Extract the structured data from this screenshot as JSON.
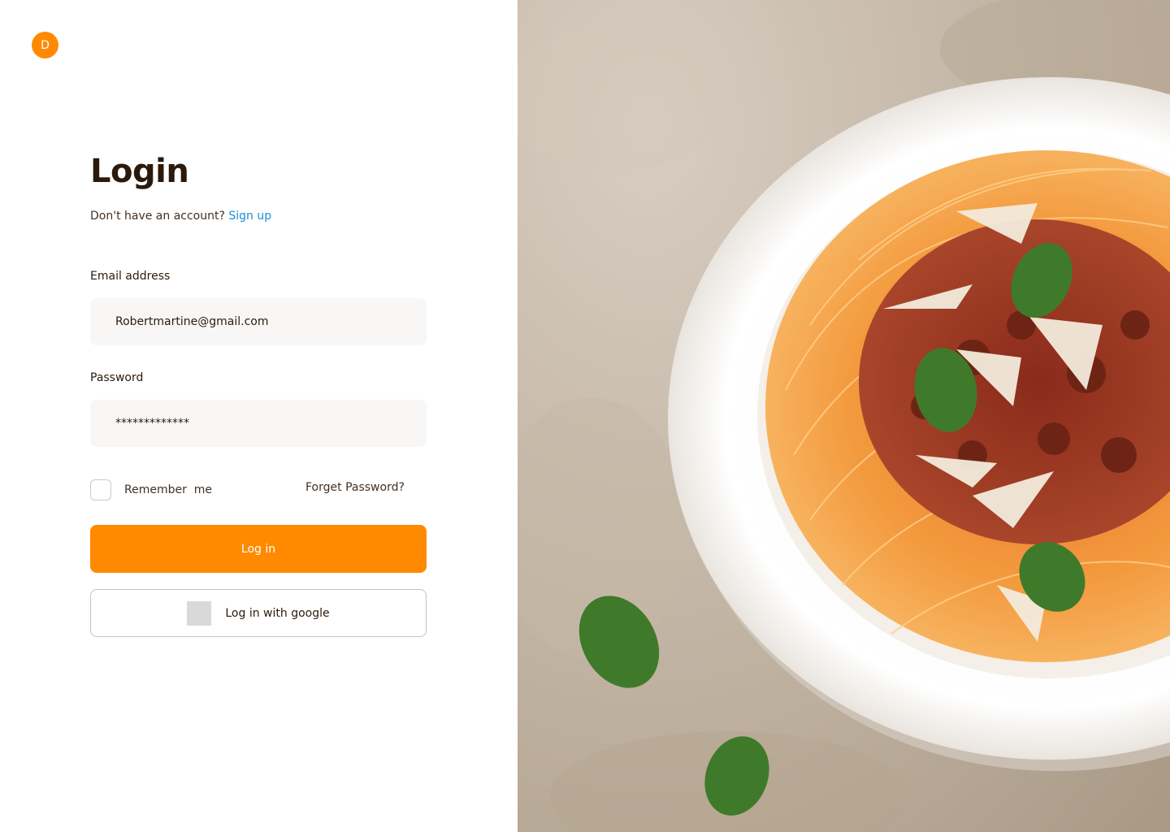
{
  "brand": {
    "logo_letter": "D"
  },
  "login": {
    "title": "Login",
    "subtitle_prefix": "Don't have an account?",
    "signup_link": "Sign up"
  },
  "email": {
    "label": "Email address",
    "value": "Robertmartine@gmail.com"
  },
  "password": {
    "label": "Password",
    "value": "*************"
  },
  "options": {
    "remember_label": "Remember  me",
    "forgot_label": "Forget Password?"
  },
  "buttons": {
    "login_label": "Log in",
    "google_label": "Log in with google"
  },
  "colors": {
    "accent": "#ff8a00",
    "link": "#1a8fd6",
    "text_dark": "#2b1a0c",
    "field_bg": "#f8f7f5"
  }
}
